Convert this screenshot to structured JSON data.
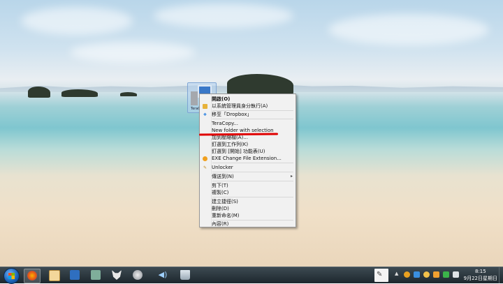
{
  "desktop": {
    "icon_label": "TeraCopy"
  },
  "context_menu": {
    "items": [
      {
        "label": "開啟(O)",
        "bold": true,
        "icon": "none"
      },
      {
        "label": "以系統管理員身分執行(A)",
        "icon": "shield-icon"
      },
      {
        "label": "移至「Dropbox」",
        "icon": "dropbox-icon"
      },
      {
        "label": "TeraCopy...",
        "icon": "none"
      },
      {
        "label": "New folder with selection",
        "icon": "none"
      },
      {
        "label": "加到壓縮檔(A)...",
        "icon": "none"
      },
      {
        "label": "釘選到工作列(K)",
        "icon": "none"
      },
      {
        "label": "釘選到 [開始] 功能表(U)",
        "icon": "none"
      },
      {
        "label": "EXE   Change File Extension...",
        "icon": "exe-icon"
      },
      {
        "label": "Unlocker",
        "icon": "unlocker-icon"
      },
      {
        "label": "傳送到(N)",
        "icon": "none",
        "submenu": true
      },
      {
        "label": "剪下(T)",
        "icon": "none"
      },
      {
        "label": "複製(C)",
        "icon": "none"
      },
      {
        "label": "建立捷徑(S)",
        "icon": "none"
      },
      {
        "label": "刪除(D)",
        "icon": "none"
      },
      {
        "label": "重新命名(M)",
        "icon": "none"
      },
      {
        "label": "內容(R)",
        "icon": "none"
      }
    ],
    "highlight_color": "#e00000"
  },
  "taskbar": {
    "apps": [
      "firefox-icon",
      "checklist-icon",
      "mp3-icon",
      "money-icon",
      "fox-icon",
      "globe-icon",
      "speaker-icon",
      "recycle-bin-icon"
    ],
    "clock_time": "8:15",
    "clock_date": "9月22日星期日"
  }
}
